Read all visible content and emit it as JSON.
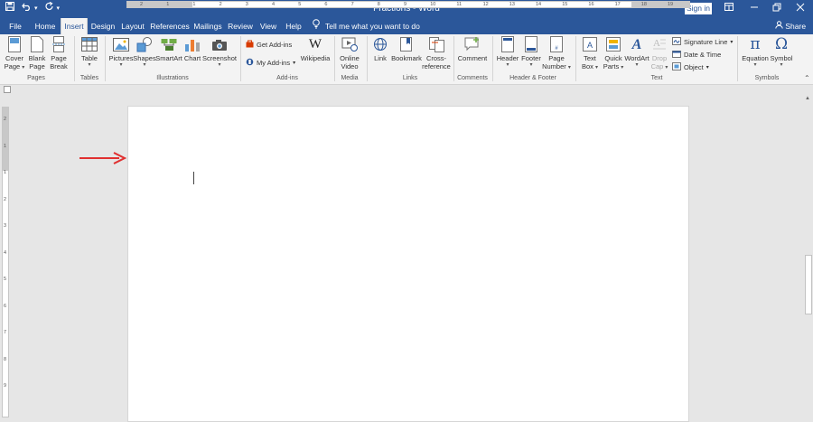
{
  "window": {
    "title": "Fractions - Word",
    "signin_label": "Sign in"
  },
  "tabs": [
    {
      "label": "File"
    },
    {
      "label": "Home"
    },
    {
      "label": "Insert"
    },
    {
      "label": "Design"
    },
    {
      "label": "Layout"
    },
    {
      "label": "References"
    },
    {
      "label": "Mailings"
    },
    {
      "label": "Review"
    },
    {
      "label": "View"
    },
    {
      "label": "Help"
    }
  ],
  "tellme_label": "Tell me what you want to do",
  "share_label": "Share",
  "ribbon": {
    "pages": {
      "label": "Pages",
      "cover": "Cover",
      "cover2": "Page",
      "blank": "Blank",
      "blank2": "Page",
      "break": "Page",
      "break2": "Break"
    },
    "tables": {
      "label": "Tables",
      "table": "Table"
    },
    "illustrations": {
      "label": "Illustrations",
      "pictures": "Pictures",
      "shapes": "Shapes",
      "smartart": "SmartArt",
      "chart": "Chart",
      "screenshot": "Screenshot"
    },
    "addins": {
      "label": "Add-ins",
      "get": "Get Add-ins",
      "my": "My Add-ins",
      "wikipedia": "Wikipedia"
    },
    "media": {
      "label": "Media",
      "online": "Online",
      "video": "Video"
    },
    "links": {
      "label": "Links",
      "link": "Link",
      "bookmark": "Bookmark",
      "cross": "Cross-",
      "reference": "reference"
    },
    "comments": {
      "label": "Comments",
      "comment": "Comment"
    },
    "headerfooter": {
      "label": "Header & Footer",
      "header": "Header",
      "footer": "Footer",
      "pagenum": "Page",
      "pagenum2": "Number"
    },
    "text": {
      "label": "Text",
      "textbox": "Text",
      "textbox2": "Box",
      "quickparts": "Quick",
      "quickparts2": "Parts",
      "wordart": "WordArt",
      "dropcap": "Drop",
      "dropcap2": "Cap",
      "signature": "Signature Line",
      "datetime": "Date & Time",
      "object": "Object"
    },
    "symbols": {
      "label": "Symbols",
      "equation": "Equation",
      "symbol": "Symbol"
    }
  },
  "ruler": {
    "h_ticks": [
      "2",
      "1",
      "1",
      "2",
      "3",
      "4",
      "5",
      "6",
      "7",
      "8",
      "9",
      "10",
      "11",
      "12",
      "13",
      "14",
      "15",
      "16",
      "17",
      "18",
      "19"
    ],
    "v_ticks": [
      "2",
      "1",
      "1",
      "2",
      "3",
      "4",
      "5",
      "6",
      "7",
      "8",
      "9"
    ]
  },
  "colors": {
    "brand": "#2b579a",
    "arrow": "#e03030"
  }
}
